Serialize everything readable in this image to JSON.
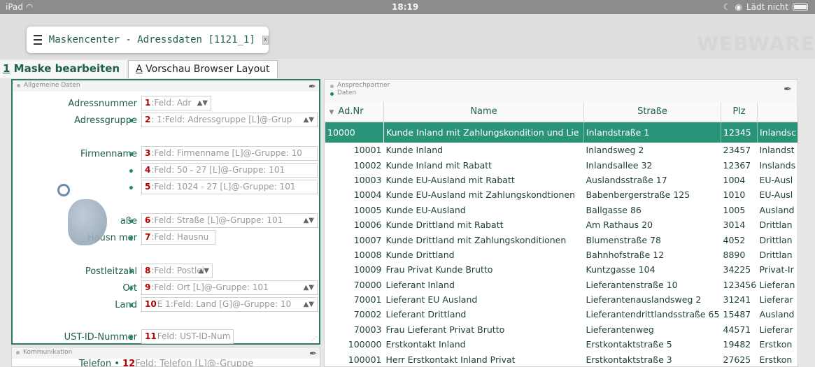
{
  "status": {
    "device": "iPad",
    "time": "18:19",
    "charging": "Lädt nicht"
  },
  "window": {
    "title": "Maskencenter - Adressdaten [1121_1]",
    "close": "x",
    "watermark": "WEBWARE"
  },
  "tabs": [
    {
      "key": "1",
      "rest": " Maske bearbeiten"
    },
    {
      "key": "A",
      "rest": " Vorschau Browser Layout"
    }
  ],
  "form": {
    "panel_title": "Allgemeine Daten",
    "rows": [
      {
        "label": "Adressnummer",
        "num": "1",
        "text": ":Feld: Adr"
      },
      {
        "label": "Adressgruppe",
        "num": "2",
        "text": ":  1:Feld: Adressgruppe  [L]@-Grup"
      },
      {
        "label": "Firmenname",
        "num": "3",
        "text": ":Feld: Firmenname  [L]@-Gruppe: 10"
      },
      {
        "label": "",
        "num": "4",
        "text": ":Feld: 50 - 27 [L]@-Gruppe: 101"
      },
      {
        "label": "",
        "num": "5",
        "text": ":Feld: 1024 - 27 [L]@-Gruppe: 101"
      },
      {
        "label": "aße",
        "num": "6",
        "text": ":Feld: Straße  [L]@-Gruppe: 101"
      },
      {
        "label": "Hausn     mer",
        "num": "7",
        "text": ":Feld: Hausnu"
      },
      {
        "label": "Postleitzahl",
        "num": "8",
        "text": ":Feld: Postlei"
      },
      {
        "label": "Ort",
        "num": "9",
        "text": ":Feld: Ort  [L]@-Gruppe: 101"
      },
      {
        "label": "Land",
        "num": "10",
        "text": "E  1:Feld: Land  [G]@-Gruppe: 10"
      },
      {
        "label": "UST-ID-Nummer",
        "num": "11",
        "text": "Feld: UST-ID-Num"
      }
    ]
  },
  "comm": {
    "panel_title": "Kommunikation",
    "row_label": "Telefon",
    "row_num": "12",
    "row_text": "Feld: Telefon  [L]@-Gruppe"
  },
  "table": {
    "head1": "Ansprechpartner",
    "head2": "Daten",
    "columns": [
      "Ad.Nr",
      "Name",
      "Straße",
      "Plz",
      ""
    ],
    "rows": [
      [
        "10000",
        "Kunde Inland mit Zahlungskondition und Lie",
        "Inlandstraße 1",
        "12345",
        "Inlandsc"
      ],
      [
        "10001",
        "Kunde Inland",
        "Inlandsweg 2",
        "23457",
        "Inlandst"
      ],
      [
        "10002",
        "Kunde Inland mit Rabatt",
        "Inlandsallee 32",
        "12367",
        "Inslands"
      ],
      [
        "10003",
        "Kunde EU-Ausland mit Rabatt",
        "Auslandsstraße 17",
        "1004",
        "EU-Ausl"
      ],
      [
        "10004",
        "Kunde EU-Ausland mit Zahlungskondtionen",
        "Babenbergerstraße 125",
        "1010",
        "EU-Ausl"
      ],
      [
        "10005",
        "Kunde EU-Ausland",
        "Ballgasse 86",
        "1005",
        "Ausland"
      ],
      [
        "10006",
        "Kunde Drittland mit Rabatt",
        "Am Rathaus 20",
        "3014",
        "Drittlan"
      ],
      [
        "10007",
        "Kunde Drittland mit Zahlungskonditionen",
        "Blumenstraße 78",
        "4052",
        "Drittlan"
      ],
      [
        "10008",
        "Kunde Drittland",
        "Bahnhofstraße 12",
        "8890",
        "Drittlan"
      ],
      [
        "10009",
        "Frau Privat Kunde Brutto",
        "Kuntzgasse 104",
        "34225",
        "Privat-Ir"
      ],
      [
        "70000",
        "Lieferant Inland",
        "Lieferantenstraße 10",
        "123456",
        "Lieferan"
      ],
      [
        "70001",
        "Lieferant EU Ausland",
        "Lieferantenauslandsweg 2",
        "31241",
        "Lieferar"
      ],
      [
        "70002",
        "Lieferant Drittland",
        "Lieferantendrittlandsstraße 65",
        "15487",
        "Ausland"
      ],
      [
        "70003",
        "Frau Lieferant Privat Brutto",
        "Lieferantenweg",
        "44571",
        "Lieferar"
      ],
      [
        "100000",
        "Erstkontakt Inland",
        "Erstkontaktstraße 5",
        "19482",
        "Erstkon"
      ],
      [
        "100001",
        "Herr Erstkontakt Inland Privat",
        "Erstkontaktstraße 3",
        "27625",
        "Erstkon"
      ]
    ]
  }
}
